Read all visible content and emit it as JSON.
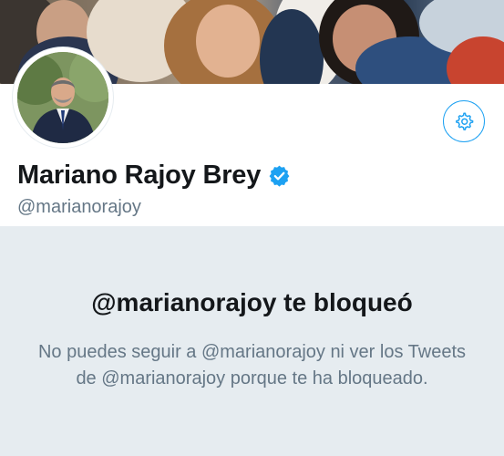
{
  "profile": {
    "display_name": "Mariano Rajoy Brey",
    "handle": "@marianorajoy",
    "verified": true
  },
  "icons": {
    "settings": "gear-icon",
    "verified": "verified-badge-icon"
  },
  "blocked": {
    "title": "@marianorajoy te bloqueó",
    "message": "No puedes seguir a @marianorajoy ni ver los Tweets de @marianorajoy porque te ha bloqueado."
  },
  "colors": {
    "accent": "#1da1f2",
    "text_primary": "#14171a",
    "text_secondary": "#657786",
    "panel_background": "#e6ecf0"
  }
}
